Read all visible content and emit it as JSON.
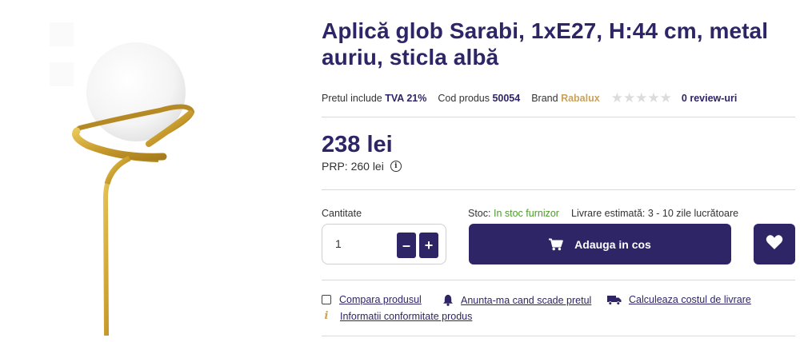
{
  "product": {
    "title": "Aplică glob Sarabi, 1xE27, H:44 cm, metal auriu, sticla albă",
    "vat_label": "Pretul include",
    "vat_value": "TVA 21%",
    "code_label": "Cod produs",
    "code_value": "50054",
    "brand_label": "Brand",
    "brand_value": "Rabalux",
    "stars": "★★★★★",
    "rating_out_of": 5,
    "rating_value": 0,
    "reviews": "0 review-uri",
    "image_icon": "lamp-product-image"
  },
  "pricing": {
    "price": "238 lei",
    "prp": "PRP: 260 lei",
    "info_glyph": "i"
  },
  "purchase": {
    "qty_label": "Cantitate",
    "qty_value": "1",
    "minus": "–",
    "plus": "+",
    "stock_label": "Stoc:",
    "stock_value": "In stoc furnizor",
    "delivery": "Livrare estimată: 3 - 10 zile lucrătoare",
    "add_to_cart": "Adauga in cos",
    "cart_icon": "shopping-cart-icon",
    "wishlist_icon": "heart-icon"
  },
  "actions": {
    "compare": "Compara produsul",
    "notify": "Anunta-ma cand scade pretul",
    "shipping": "Calculeaza costul de livrare",
    "conformity": "Informatii conformitate produs",
    "conformity_glyph": "i"
  },
  "colors": {
    "primary": "#2e2566",
    "gold": "#c9a35c",
    "stock_green": "#4f9a2f",
    "star_empty": "#dcdcdc"
  }
}
